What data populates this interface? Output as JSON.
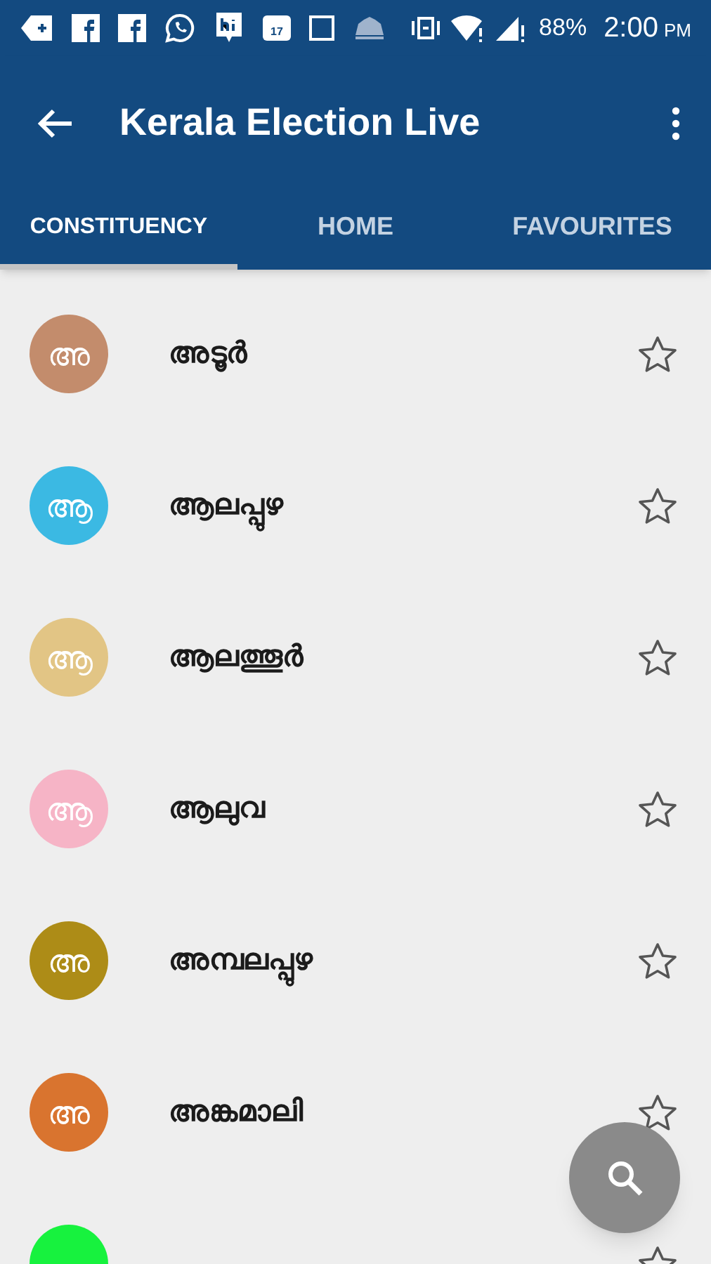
{
  "status_bar": {
    "calendar_day": "17",
    "battery": "88%",
    "time": "2:00",
    "period": "PM"
  },
  "app_bar": {
    "title": "Kerala Election Live"
  },
  "tabs": [
    {
      "label": "CONSTITUENCY",
      "selected": true
    },
    {
      "label": "HOME",
      "selected": false
    },
    {
      "label": "FAVOURITES",
      "selected": false
    }
  ],
  "constituencies": [
    {
      "letter": "അ",
      "name": "അടൂർ",
      "color": "#c38c6c",
      "favourite": false
    },
    {
      "letter": "ആ",
      "name": "ആലപ്പുഴ",
      "color": "#3bb9e3",
      "favourite": false
    },
    {
      "letter": "ആ",
      "name": "ആലത്തൂർ",
      "color": "#e2c585",
      "favourite": false
    },
    {
      "letter": "ആ",
      "name": "ആലുവ",
      "color": "#f6b4c6",
      "favourite": false
    },
    {
      "letter": "അ",
      "name": "അമ്പലപ്പുഴ",
      "color": "#ad8c17",
      "favourite": false
    },
    {
      "letter": "അ",
      "name": "അങ്കമാലി",
      "color": "#d9742f",
      "favourite": false
    },
    {
      "color": "#17f23e",
      "favourite": false
    }
  ]
}
